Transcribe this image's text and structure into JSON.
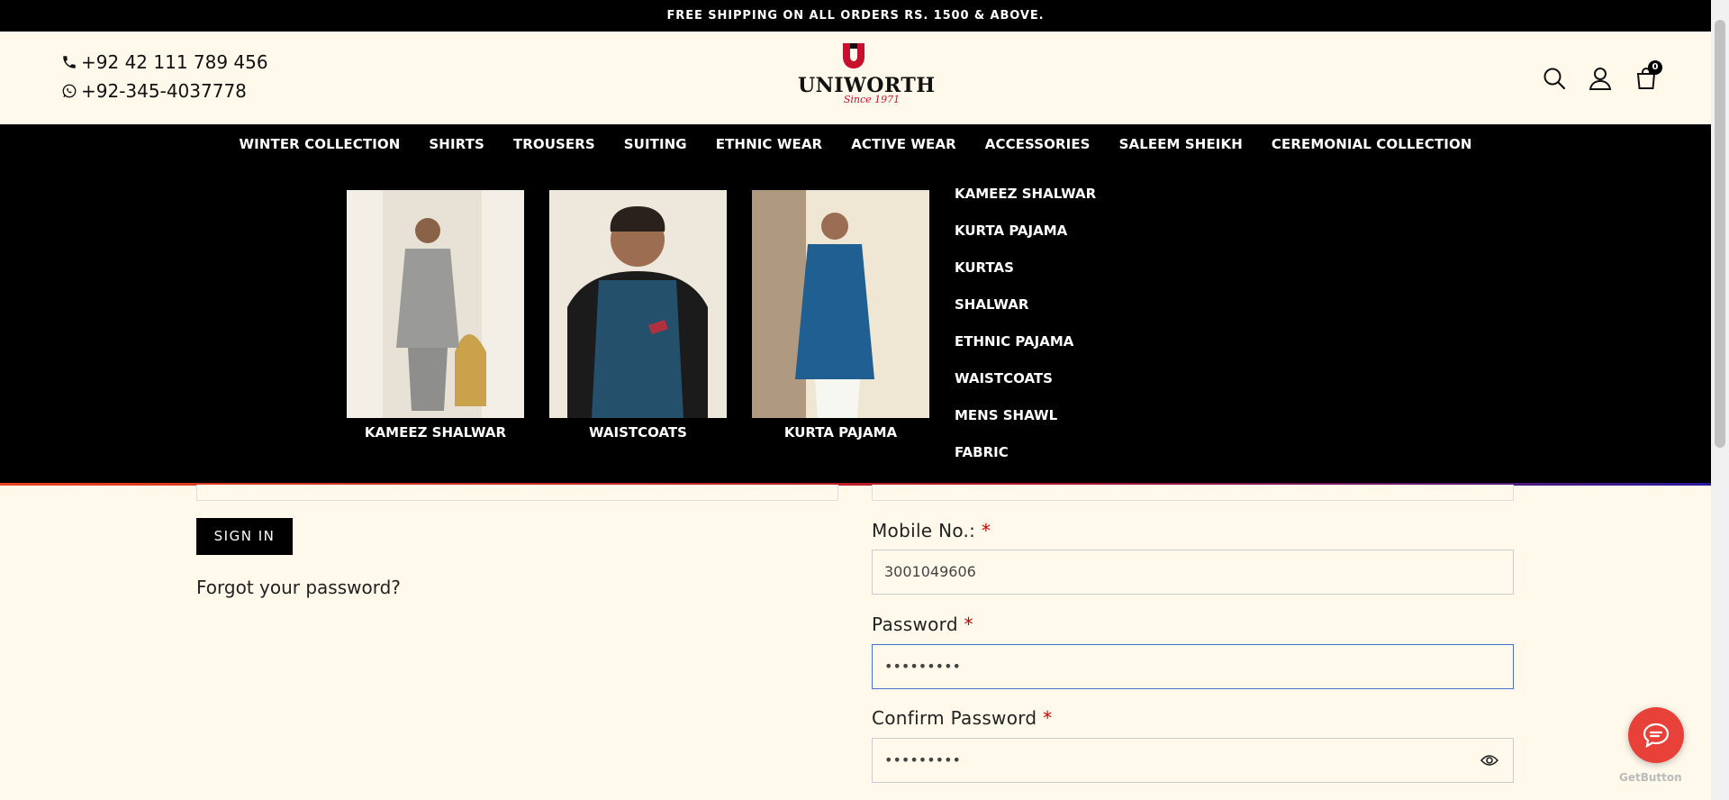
{
  "announcement": "FREE SHIPPING ON ALL ORDERS RS. 1500 & ABOVE.",
  "header": {
    "phone": "+92 42 111 789 456",
    "whatsapp": "+92-345-4037778",
    "logo_text": "UNIWORTH",
    "logo_since": "Since 1971",
    "cart_count": "0"
  },
  "nav": {
    "items": [
      "WINTER COLLECTION",
      "SHIRTS",
      "TROUSERS",
      "SUITING",
      "ETHNIC WEAR",
      "ACTIVE WEAR",
      "ACCESSORIES",
      "SALEEM SHEIKH",
      "CEREMONIAL COLLECTION"
    ]
  },
  "mega_menu": {
    "cards": [
      {
        "label": "KAMEEZ SHALWAR"
      },
      {
        "label": "WAISTCOATS"
      },
      {
        "label": "KURTA PAJAMA"
      }
    ],
    "links": [
      "KAMEEZ SHALWAR",
      "KURTA PAJAMA",
      "KURTAS",
      "SHALWAR",
      "ETHNIC PAJAMA",
      "WAISTCOATS",
      "MENS SHAWL",
      "FABRIC"
    ]
  },
  "login": {
    "signin_label": "SIGN IN",
    "forgot_label": "Forgot your password?"
  },
  "register": {
    "mobile_label": "Mobile No.:",
    "mobile_value": "3001049606",
    "password_label": "Password",
    "password_value": "•••••••••",
    "confirm_label": "Confirm Password",
    "confirm_value": "•••••••••",
    "required_mark": "*"
  },
  "chat_widget": {
    "brand": "GetButton"
  }
}
